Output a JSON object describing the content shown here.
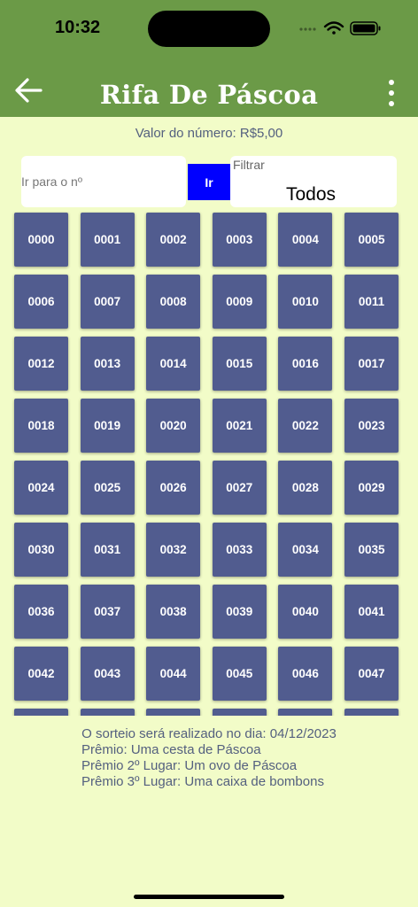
{
  "status": {
    "time": "10:32"
  },
  "header": {
    "title": "Rifa De Páscoa",
    "back_icon": "arrow-left-icon",
    "menu_icon": "vertical-dots-icon"
  },
  "price_text": "Valor do número: R$5,00",
  "goto": {
    "placeholder": "Ir para o nº",
    "button_label": "Ir"
  },
  "filter": {
    "label": "Filtrar",
    "value": "Todos"
  },
  "numbers": [
    "0000",
    "0001",
    "0002",
    "0003",
    "0004",
    "0005",
    "0006",
    "0007",
    "0008",
    "0009",
    "0010",
    "0011",
    "0012",
    "0013",
    "0014",
    "0015",
    "0016",
    "0017",
    "0018",
    "0019",
    "0020",
    "0021",
    "0022",
    "0023",
    "0024",
    "0025",
    "0026",
    "0027",
    "0028",
    "0029",
    "0030",
    "0031",
    "0032",
    "0033",
    "0034",
    "0035",
    "0036",
    "0037",
    "0038",
    "0039",
    "0040",
    "0041",
    "0042",
    "0043",
    "0044",
    "0045",
    "0046",
    "0047"
  ],
  "info": {
    "draw_date": "O sorteio será realizado no dia: 04/12/2023",
    "prize1": "Prêmio: Uma cesta de Páscoa",
    "prize2": "Prêmio 2º Lugar: Um ovo de Páscoa",
    "prize3": "Prêmio 3º Lugar: Uma caixa de bombons"
  },
  "colors": {
    "header": "#6b9a47",
    "background": "#f2fcc8",
    "cell": "#515c8f",
    "go_button": "#0000ff",
    "info_text": "#54607f"
  }
}
